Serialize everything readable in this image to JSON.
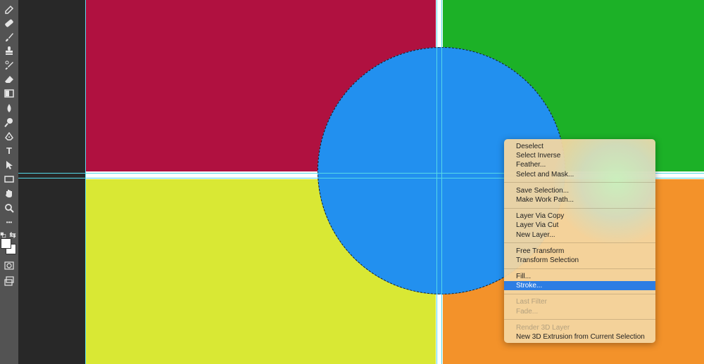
{
  "toolbar": {
    "tools": [
      {
        "icon": "eyedropper-icon"
      },
      {
        "icon": "healing-brush-icon"
      },
      {
        "icon": "brush-icon"
      },
      {
        "icon": "clone-stamp-icon"
      },
      {
        "icon": "history-brush-icon"
      },
      {
        "icon": "eraser-icon"
      },
      {
        "icon": "gradient-icon"
      },
      {
        "icon": "blur-icon"
      },
      {
        "icon": "dodge-icon"
      },
      {
        "icon": "pen-icon"
      },
      {
        "icon": "type-icon",
        "glyph": "T"
      },
      {
        "icon": "path-selection-icon"
      },
      {
        "icon": "rectangle-icon"
      },
      {
        "icon": "hand-icon"
      },
      {
        "icon": "zoom-icon"
      },
      {
        "icon": "more-tools-icon",
        "glyph": "•••"
      },
      {
        "icon": "default-colors-icon"
      },
      {
        "icon": "swap-colors-icon",
        "glyph": "⇆"
      },
      {
        "icon": "quick-mask-icon"
      },
      {
        "icon": "screen-mode-icon"
      }
    ],
    "foreground_color": "#ffffff",
    "background_color": "#ffffff"
  },
  "canvas": {
    "colors": {
      "crimson": "#b01140",
      "green": "#1cb127",
      "yellow": "#d9e834",
      "orange": "#f3922a",
      "blue": "#2290ef",
      "guide": "#55d9e8"
    }
  },
  "context_menu": {
    "groups": [
      [
        {
          "label": "Deselect",
          "state": "normal"
        },
        {
          "label": "Select Inverse",
          "state": "normal"
        },
        {
          "label": "Feather...",
          "state": "normal"
        },
        {
          "label": "Select and Mask...",
          "state": "normal"
        }
      ],
      [
        {
          "label": "Save Selection...",
          "state": "normal"
        },
        {
          "label": "Make Work Path...",
          "state": "normal"
        }
      ],
      [
        {
          "label": "Layer Via Copy",
          "state": "normal"
        },
        {
          "label": "Layer Via Cut",
          "state": "normal"
        },
        {
          "label": "New Layer...",
          "state": "normal"
        }
      ],
      [
        {
          "label": "Free Transform",
          "state": "normal"
        },
        {
          "label": "Transform Selection",
          "state": "normal"
        }
      ],
      [
        {
          "label": "Fill...",
          "state": "normal"
        },
        {
          "label": "Stroke...",
          "state": "highlighted"
        }
      ],
      [
        {
          "label": "Last Filter",
          "state": "disabled"
        },
        {
          "label": "Fade...",
          "state": "disabled"
        }
      ],
      [
        {
          "label": "Render 3D Layer",
          "state": "disabled"
        },
        {
          "label": "New 3D Extrusion from Current Selection",
          "state": "normal"
        }
      ]
    ]
  }
}
